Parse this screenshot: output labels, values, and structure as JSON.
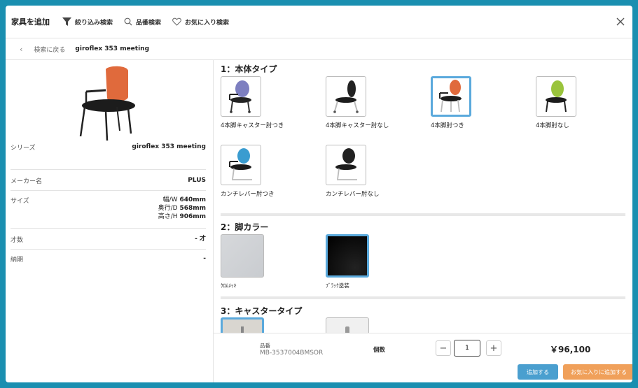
{
  "header": {
    "title": "家具を追加",
    "filter_label": "絞り込み検索",
    "code_search_label": "品番検索",
    "favorites_label": "お気に入り検索"
  },
  "breadcrumb": {
    "back_label": "検索に戻る",
    "product_name": "giroflex 353 meeting"
  },
  "specs": {
    "series_key": "シリーズ",
    "series_value": "giroflex 353 meeting",
    "maker_key": "メーカー名",
    "maker_value": "PLUS",
    "size_key": "サイズ",
    "width_label": "幅/W",
    "width_value": "640mm",
    "depth_label": "奥行/D",
    "depth_value": "568mm",
    "height_label": "高さ/H",
    "height_value": "906mm",
    "sai_key": "才数",
    "sai_value": "- 才",
    "delivery_key": "納期",
    "delivery_value": "-"
  },
  "sections": {
    "body_type": {
      "title": "1：本体タイプ",
      "options": [
        {
          "label": "4本脚キャスター肘つき"
        },
        {
          "label": "4本脚キャスター肘なし"
        },
        {
          "label": "4本脚肘つき"
        },
        {
          "label": "4本脚肘なし"
        },
        {
          "label": "カンチレバー肘つき"
        },
        {
          "label": "カンチレバー肘なし"
        }
      ],
      "selected_index": 2
    },
    "leg_color": {
      "title": "2：脚カラー",
      "options": [
        {
          "label": "ｸﾛﾑﾒｯｷ"
        },
        {
          "label": "ﾌﾞﾗｯｸ塗装"
        }
      ],
      "selected_index": 1
    },
    "caster_type": {
      "title": "3：キャスタータイプ"
    }
  },
  "footer": {
    "code_label": "品番",
    "code_value": "MB-3537004BMSOR",
    "qty_label": "個数",
    "qty_value": "1",
    "minus_label": "−",
    "plus_label": "+",
    "price": "￥96,100",
    "add_button": "追加する",
    "add_favorite_button": "お気に入りに追加する"
  },
  "colors": {
    "accent_blue": "#4a9fcf",
    "accent_orange": "#f0a05a",
    "selected_border": "#5aa9dc",
    "page_background": "#1a8fb0"
  }
}
